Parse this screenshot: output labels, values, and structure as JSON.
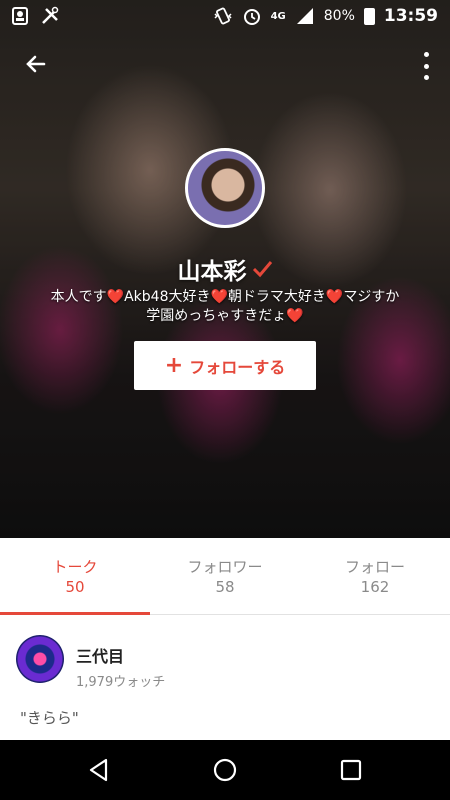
{
  "status_bar": {
    "network": "4G",
    "battery": "80%",
    "time": "13:59"
  },
  "profile": {
    "name": "山本彩",
    "bio": "本人です❤️Akb48大好き❤️朝ドラマ大好き❤️マジすか学園めっちゃすきだょ❤️",
    "follow_button": "フォローする"
  },
  "tabs": [
    {
      "label": "トーク",
      "count": "50",
      "active": true
    },
    {
      "label": "フォロワー",
      "count": "58",
      "active": false
    },
    {
      "label": "フォロー",
      "count": "162",
      "active": false
    }
  ],
  "post": {
    "author": "三代目",
    "watch_count": "1,979ウォッチ",
    "quote": "\"きらら\""
  },
  "colors": {
    "accent": "#e5483a",
    "muted_text": "#8a8a8a"
  },
  "icons": {
    "back": "arrow-left-icon",
    "more": "more-vert-icon",
    "follow": "plus-icon",
    "badge": "verified-check-icon",
    "nav_back": "triangle-back-icon",
    "nav_home": "circle-home-icon",
    "nav_recents": "square-recents-icon"
  }
}
